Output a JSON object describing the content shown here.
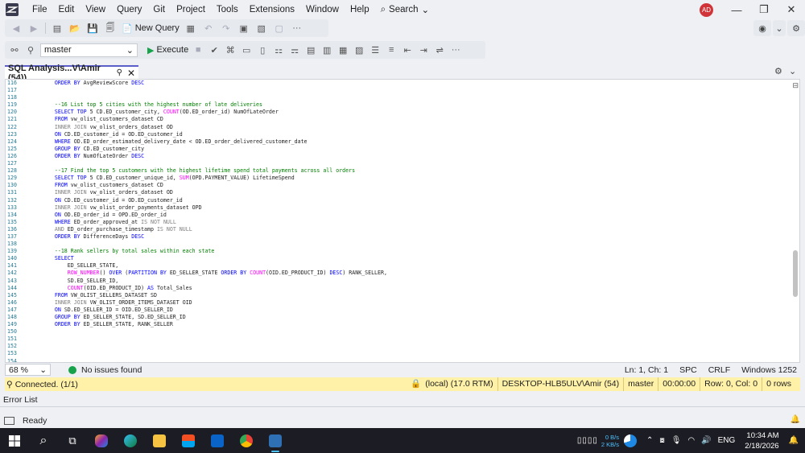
{
  "menubar": {
    "items": [
      "File",
      "Edit",
      "View",
      "Query",
      "Git",
      "Project",
      "Tools",
      "Extensions",
      "Window",
      "Help"
    ],
    "search_label": "Search",
    "avatar_initials": "AD"
  },
  "toolbar": {
    "new_query_label": "New Query",
    "database": "master",
    "execute_label": "Execute"
  },
  "tab": {
    "title": "SQL Analysis...V\\Amir (54))"
  },
  "editor": {
    "lines": [
      {
        "n": "116",
        "t": "    ORDER BY AvgReviewScore DESC"
      },
      {
        "n": "117",
        "t": ""
      },
      {
        "n": "118",
        "t": ""
      },
      {
        "n": "119",
        "t": "    --16 List top 5 cities with the highest number of late deliveries"
      },
      {
        "n": "120",
        "t": "    SELECT TOP 5 CD.ED_customer_city, COUNT(OD.ED_order_id) NumOfLateOrder"
      },
      {
        "n": "121",
        "t": "    FROM vw_olist_customers_dataset CD"
      },
      {
        "n": "122",
        "t": "    INNER JOIN vw_olist_orders_dataset OD"
      },
      {
        "n": "123",
        "t": "    ON CD.ED_customer_id = OD.ED_customer_id"
      },
      {
        "n": "124",
        "t": "    WHERE OD.ED_order_estimated_delivery_date < OD.ED_order_delivered_customer_date"
      },
      {
        "n": "125",
        "t": "    GROUP BY CD.ED_customer_city"
      },
      {
        "n": "126",
        "t": "    ORDER BY NumOfLateOrder DESC"
      },
      {
        "n": "127",
        "t": ""
      },
      {
        "n": "128",
        "t": "    --17 Find the top 5 customers with the highest lifetime spend total payments across all orders"
      },
      {
        "n": "129",
        "t": "    SELECT TOP 5 CD.ED_customer_unique_id, SUM(OPD.PAYMENT_VALUE) LifetimeSpend"
      },
      {
        "n": "130",
        "t": "    FROM vw_olist_customers_dataset CD"
      },
      {
        "n": "131",
        "t": "    INNER JOIN vw_olist_orders_dataset OD"
      },
      {
        "n": "132",
        "t": "    ON CD.ED_customer_id = OD.ED_customer_id"
      },
      {
        "n": "133",
        "t": "    INNER JOIN vw_olist_order_payments_dataset OPD"
      },
      {
        "n": "134",
        "t": "    ON OD.ED_order_id = OPD.ED_order_id"
      },
      {
        "n": "135",
        "t": "    WHERE ED_order_approved_at IS NOT NULL"
      },
      {
        "n": "136",
        "t": "    AND ED_order_purchase_timestamp IS NOT NULL"
      },
      {
        "n": "137",
        "t": "    ORDER BY DifferenceDays DESC"
      },
      {
        "n": "138",
        "t": ""
      },
      {
        "n": "139",
        "t": "    --18 Rank sellers by total sales within each state"
      },
      {
        "n": "140",
        "t": "    SELECT"
      },
      {
        "n": "141",
        "t": "        ED_SELLER_STATE,"
      },
      {
        "n": "142",
        "t": "        ROW_NUMBER() OVER (PARTITION BY ED_SELLER_STATE ORDER BY COUNT(OID.ED_PRODUCT_ID) DESC) RANK_SELLER,"
      },
      {
        "n": "143",
        "t": "        SD.ED_SELLER_ID,"
      },
      {
        "n": "144",
        "t": "        COUNT(OID.ED_PRODUCT_ID) AS Total_Sales"
      },
      {
        "n": "145",
        "t": "    FROM VW_OLIST_SELLERS_DATASET SD"
      },
      {
        "n": "146",
        "t": "    INNER JOIN VW_OLIST_ORDER_ITEMS_DATASET OID"
      },
      {
        "n": "147",
        "t": "    ON SD.ED_SELLER_ID = OID.ED_SELLER_ID"
      },
      {
        "n": "148",
        "t": "    GROUP BY ED_SELLER_STATE, SD.ED_SELLER_ID"
      },
      {
        "n": "149",
        "t": "    ORDER BY ED_SELLER_STATE, RANK_SELLER"
      },
      {
        "n": "150",
        "t": ""
      },
      {
        "n": "151",
        "t": ""
      },
      {
        "n": "152",
        "t": ""
      },
      {
        "n": "153",
        "t": ""
      },
      {
        "n": "154",
        "t": ""
      }
    ]
  },
  "editor_status": {
    "zoom": "68 %",
    "issues": "No issues found",
    "position": "Ln: 1, Ch: 1",
    "whitespace": "SPC",
    "line_ending": "CRLF",
    "encoding": "Windows 1252"
  },
  "connection_bar": {
    "status": "Connected. (1/1)",
    "server": "(local) (17.0 RTM)",
    "user": "DESKTOP-HLB5ULV\\Amir (54)",
    "database": "master",
    "elapsed": "00:00:00",
    "row_col": "Row: 0, Col: 0",
    "rows": "0 rows"
  },
  "error_list_label": "Error List",
  "status_text": "Ready",
  "taskbar": {
    "net_up": "0 B/s",
    "net_down": "2 KB/s",
    "language": "ENG",
    "time": "10:34 AM",
    "date": "2/18/2026"
  },
  "colors": {
    "accent": "#5b5fc7",
    "connection_bar": "#fff1a8",
    "keyword": "#0000ff",
    "comment": "#008000",
    "function": "#ff00ff"
  }
}
